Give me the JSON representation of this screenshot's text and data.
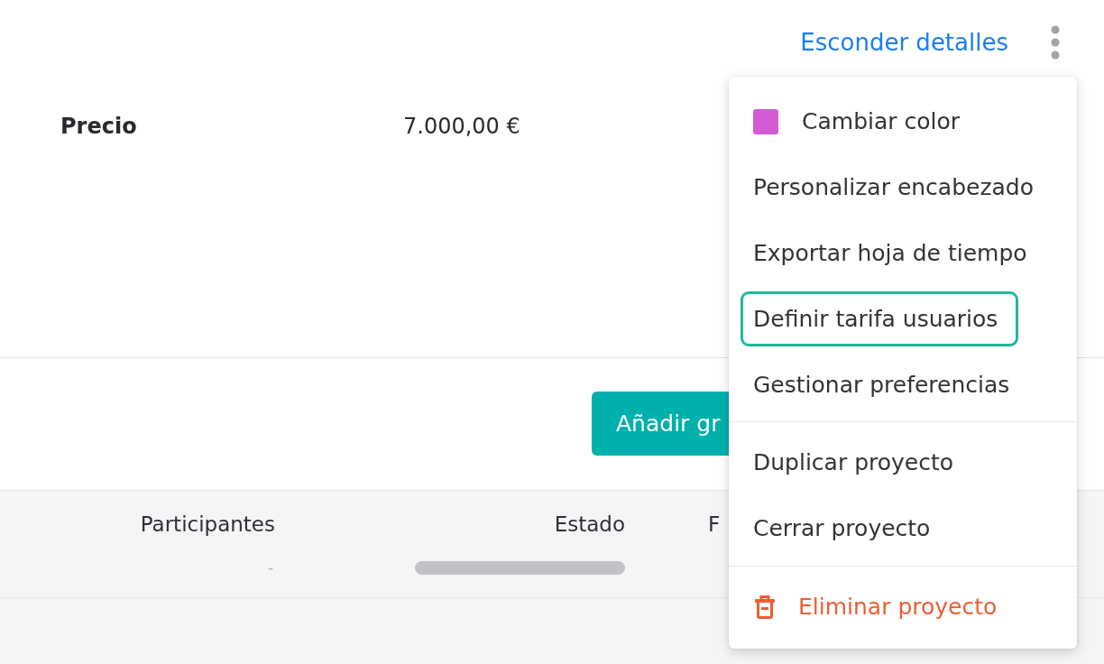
{
  "header": {
    "toggle_link": "Esconder detalles"
  },
  "details": [
    {
      "label": "Precio",
      "value": "7.000,00 €"
    }
  ],
  "add_button": {
    "label": "Añadir gr"
  },
  "table": {
    "columns": [
      "Participantes",
      "Estado",
      "F"
    ],
    "rows": [
      {
        "participants": "-"
      }
    ]
  },
  "menu": {
    "sections": [
      {
        "items": [
          {
            "kind": "color",
            "label": "Cambiar color",
            "color": "#d35bd4",
            "focused": false
          },
          {
            "kind": "action",
            "label": "Personalizar encabezado",
            "focused": false
          },
          {
            "kind": "action",
            "label": "Exportar hoja de tiempo",
            "focused": false
          },
          {
            "kind": "action",
            "label": "Definir tarifa usuarios",
            "focused": true
          },
          {
            "kind": "action",
            "label": "Gestionar preferencias",
            "focused": false
          }
        ]
      },
      {
        "items": [
          {
            "kind": "action",
            "label": "Duplicar proyecto",
            "focused": false
          },
          {
            "kind": "action",
            "label": "Cerrar proyecto",
            "focused": false
          }
        ]
      },
      {
        "items": [
          {
            "kind": "danger",
            "label": "Eliminar proyecto",
            "focused": false
          }
        ]
      }
    ]
  }
}
